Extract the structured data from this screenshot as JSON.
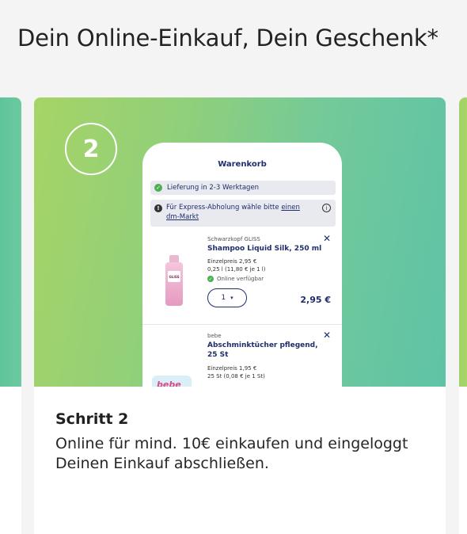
{
  "header": {
    "title": "Dein Online-Einkauf, Dein Geschenk*"
  },
  "step": {
    "number": "2",
    "title": "Schritt 2",
    "description": "Online für mind. 10€ einkaufen und eingeloggt Deinen Einkauf abschließen."
  },
  "phone": {
    "title": "Warenkorb",
    "delivery": "Lieferung in 2-3 Werktagen",
    "express_text": "Für Express-Abholung wähle bitte ",
    "express_link": "einen dm-Markt",
    "items": [
      {
        "brand": "Schwarzkopf GLISS",
        "name": "Shampoo Liquid Silk, 250 ml",
        "unit_price": "Einzelpreis 2,95 €",
        "unit_detail": "0,25 l (11,80 € je 1 l)",
        "availability": "Online verfügbar",
        "quantity": "1",
        "price": "2,95 €",
        "image_label": "GLISS"
      },
      {
        "brand": "bebe",
        "name": "Abschminktücher pflegend, 25 St",
        "unit_price": "Einzelpreis 1,95 €",
        "unit_detail": "25 St (0,08 € je 1 St)",
        "image_label": "bebe"
      }
    ]
  },
  "colors": {
    "gradient_start": "#a6d466",
    "gradient_end": "#5ec3a6",
    "navy": "#1f2d6b",
    "green_check": "#4caf50"
  },
  "icons": {
    "check": "check-circle-icon",
    "info": "info-icon",
    "alert": "alert-circle-icon",
    "close": "close-icon",
    "chevron": "chevron-down-icon"
  }
}
